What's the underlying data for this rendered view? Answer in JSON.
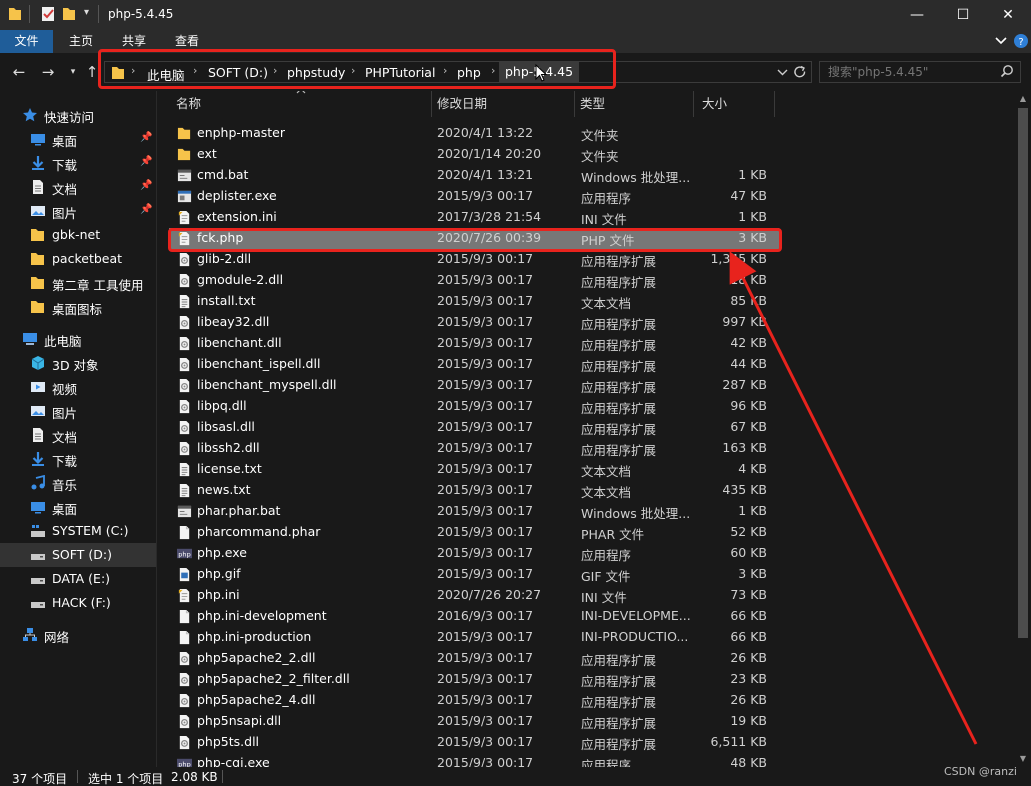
{
  "window": {
    "title": "php-5.4.45",
    "controls": {
      "minimize": "—",
      "maximize": "☐",
      "close": "✕"
    }
  },
  "ribbon": {
    "tabs": [
      "文件",
      "主页",
      "共享",
      "查看"
    ],
    "expand_icon": "chevron-down-icon",
    "help_icon": "help-icon"
  },
  "nav": {
    "back_icon": "arrow-left-icon",
    "forward_icon": "arrow-right-icon",
    "recent_icon": "chevron-down-icon",
    "up_icon": "arrow-up-icon"
  },
  "address": {
    "breadcrumbs": [
      "此电脑",
      "SOFT (D:)",
      "phpstudy",
      "PHPTutorial",
      "php",
      "php-5.4.45"
    ],
    "refresh_icon": "refresh-icon"
  },
  "search": {
    "placeholder": "搜索\"php-5.4.45\""
  },
  "sidebar": {
    "items": [
      {
        "label": "快速访问",
        "icon": "star-icon",
        "pinned": false
      },
      {
        "label": "桌面",
        "icon": "desktop-icon",
        "pinned": true
      },
      {
        "label": "下载",
        "icon": "download-icon",
        "pinned": true
      },
      {
        "label": "文档",
        "icon": "document-icon",
        "pinned": true
      },
      {
        "label": "图片",
        "icon": "picture-icon",
        "pinned": true
      },
      {
        "label": "gbk-net",
        "icon": "folder-icon",
        "pinned": false
      },
      {
        "label": "packetbeat",
        "icon": "folder-icon",
        "pinned": false
      },
      {
        "label": "第二章 工具使用",
        "icon": "folder-icon",
        "pinned": false
      },
      {
        "label": "桌面图标",
        "icon": "folder-icon",
        "pinned": false
      },
      {
        "label": "此电脑",
        "icon": "computer-icon",
        "pinned": false
      },
      {
        "label": "3D 对象",
        "icon": "cube-icon",
        "pinned": false
      },
      {
        "label": "视频",
        "icon": "video-icon",
        "pinned": false
      },
      {
        "label": "图片",
        "icon": "picture-icon",
        "pinned": false
      },
      {
        "label": "文档",
        "icon": "document-icon",
        "pinned": false
      },
      {
        "label": "下载",
        "icon": "download-icon",
        "pinned": false
      },
      {
        "label": "音乐",
        "icon": "music-icon",
        "pinned": false
      },
      {
        "label": "桌面",
        "icon": "desktop-icon",
        "pinned": false
      },
      {
        "label": "SYSTEM (C:)",
        "icon": "windows-drive-icon",
        "pinned": false
      },
      {
        "label": "SOFT (D:)",
        "icon": "drive-icon",
        "pinned": false,
        "selected": true
      },
      {
        "label": "DATA (E:)",
        "icon": "drive-icon",
        "pinned": false
      },
      {
        "label": "HACK (F:)",
        "icon": "drive-icon",
        "pinned": false
      },
      {
        "label": "网络",
        "icon": "network-icon",
        "pinned": false
      }
    ]
  },
  "columns": [
    "名称",
    "修改日期",
    "类型",
    "大小"
  ],
  "files": [
    {
      "name": "enphp-master",
      "date": "2020/4/1 13:22",
      "type": "文件夹",
      "size": "",
      "icon": "folder-icon"
    },
    {
      "name": "ext",
      "date": "2020/1/14 20:20",
      "type": "文件夹",
      "size": "",
      "icon": "folder-icon"
    },
    {
      "name": "cmd.bat",
      "date": "2020/4/1 13:21",
      "type": "Windows 批处理...",
      "size": "1 KB",
      "icon": "batch-file-icon"
    },
    {
      "name": "deplister.exe",
      "date": "2015/9/3 00:17",
      "type": "应用程序",
      "size": "47 KB",
      "icon": "exe-icon"
    },
    {
      "name": "extension.ini",
      "date": "2017/3/28 21:54",
      "type": "INI 文件",
      "size": "1 KB",
      "icon": "ini-file-icon"
    },
    {
      "name": "fck.php",
      "date": "2020/7/26 00:39",
      "type": "PHP 文件",
      "size": "3 KB",
      "icon": "php-file-icon",
      "selected": true
    },
    {
      "name": "glib-2.dll",
      "date": "2015/9/3 00:17",
      "type": "应用程序扩展",
      "size": "1,345 KB",
      "icon": "dll-icon"
    },
    {
      "name": "gmodule-2.dll",
      "date": "2015/9/3 00:17",
      "type": "应用程序扩展",
      "size": "18 KB",
      "icon": "dll-icon"
    },
    {
      "name": "install.txt",
      "date": "2015/9/3 00:17",
      "type": "文本文档",
      "size": "85 KB",
      "icon": "text-file-icon"
    },
    {
      "name": "libeay32.dll",
      "date": "2015/9/3 00:17",
      "type": "应用程序扩展",
      "size": "997 KB",
      "icon": "dll-icon"
    },
    {
      "name": "libenchant.dll",
      "date": "2015/9/3 00:17",
      "type": "应用程序扩展",
      "size": "42 KB",
      "icon": "dll-icon"
    },
    {
      "name": "libenchant_ispell.dll",
      "date": "2015/9/3 00:17",
      "type": "应用程序扩展",
      "size": "44 KB",
      "icon": "dll-icon"
    },
    {
      "name": "libenchant_myspell.dll",
      "date": "2015/9/3 00:17",
      "type": "应用程序扩展",
      "size": "287 KB",
      "icon": "dll-icon"
    },
    {
      "name": "libpq.dll",
      "date": "2015/9/3 00:17",
      "type": "应用程序扩展",
      "size": "96 KB",
      "icon": "dll-icon"
    },
    {
      "name": "libsasl.dll",
      "date": "2015/9/3 00:17",
      "type": "应用程序扩展",
      "size": "67 KB",
      "icon": "dll-icon"
    },
    {
      "name": "libssh2.dll",
      "date": "2015/9/3 00:17",
      "type": "应用程序扩展",
      "size": "163 KB",
      "icon": "dll-icon"
    },
    {
      "name": "license.txt",
      "date": "2015/9/3 00:17",
      "type": "文本文档",
      "size": "4 KB",
      "icon": "text-file-icon"
    },
    {
      "name": "news.txt",
      "date": "2015/9/3 00:17",
      "type": "文本文档",
      "size": "435 KB",
      "icon": "text-file-icon"
    },
    {
      "name": "phar.phar.bat",
      "date": "2015/9/3 00:17",
      "type": "Windows 批处理...",
      "size": "1 KB",
      "icon": "batch-file-icon"
    },
    {
      "name": "pharcommand.phar",
      "date": "2015/9/3 00:17",
      "type": "PHAR 文件",
      "size": "52 KB",
      "icon": "blank-file-icon"
    },
    {
      "name": "php.exe",
      "date": "2015/9/3 00:17",
      "type": "应用程序",
      "size": "60 KB",
      "icon": "php-exe-icon"
    },
    {
      "name": "php.gif",
      "date": "2015/9/3 00:17",
      "type": "GIF 文件",
      "size": "3 KB",
      "icon": "image-file-icon"
    },
    {
      "name": "php.ini",
      "date": "2020/7/26 20:27",
      "type": "INI 文件",
      "size": "73 KB",
      "icon": "ini-file-icon"
    },
    {
      "name": "php.ini-development",
      "date": "2016/9/3 00:17",
      "type": "INI-DEVELOPME...",
      "size": "66 KB",
      "icon": "blank-file-icon"
    },
    {
      "name": "php.ini-production",
      "date": "2015/9/3 00:17",
      "type": "INI-PRODUCTIO...",
      "size": "66 KB",
      "icon": "blank-file-icon"
    },
    {
      "name": "php5apache2_2.dll",
      "date": "2015/9/3 00:17",
      "type": "应用程序扩展",
      "size": "26 KB",
      "icon": "dll-icon"
    },
    {
      "name": "php5apache2_2_filter.dll",
      "date": "2015/9/3 00:17",
      "type": "应用程序扩展",
      "size": "23 KB",
      "icon": "dll-icon"
    },
    {
      "name": "php5apache2_4.dll",
      "date": "2015/9/3 00:17",
      "type": "应用程序扩展",
      "size": "26 KB",
      "icon": "dll-icon"
    },
    {
      "name": "php5nsapi.dll",
      "date": "2015/9/3 00:17",
      "type": "应用程序扩展",
      "size": "19 KB",
      "icon": "dll-icon"
    },
    {
      "name": "php5ts.dll",
      "date": "2015/9/3 00:17",
      "type": "应用程序扩展",
      "size": "6,511 KB",
      "icon": "dll-icon"
    },
    {
      "name": "php-cgi.exe",
      "date": "2015/9/3 00:17",
      "type": "应用程序",
      "size": "48 KB",
      "icon": "php-exe-icon"
    }
  ],
  "status": {
    "item_count": "37 个项目",
    "selected": "选中 1 个项目",
    "selected_size": "2.08 KB"
  },
  "watermark": "CSDN @ranzi",
  "colors": {
    "background": "#191919",
    "titlebar": "#2b2b2b",
    "file_tab": "#1f5d99",
    "selected_row": "#777777",
    "annotation": "#e8231d",
    "folder": "#f6c34a"
  }
}
